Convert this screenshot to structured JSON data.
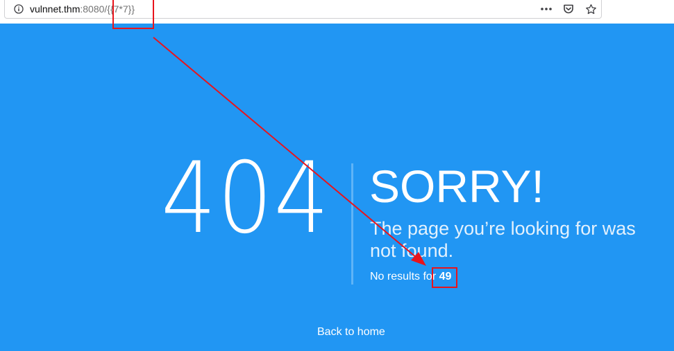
{
  "browser": {
    "url_host": "vulnnet.thm",
    "url_rest": ":8080/{{7*7}}",
    "icons": [
      "info-icon",
      "more-icon",
      "pocket-icon",
      "star-icon"
    ]
  },
  "page": {
    "code": "404",
    "heading": "SORRY!",
    "message": "The page you’re looking for was not found.",
    "no_results_prefix": "No results for",
    "no_results_value": "49",
    "back_link": "Back to home"
  },
  "colors": {
    "background": "#2196f3",
    "annotation": "#e8141c"
  }
}
